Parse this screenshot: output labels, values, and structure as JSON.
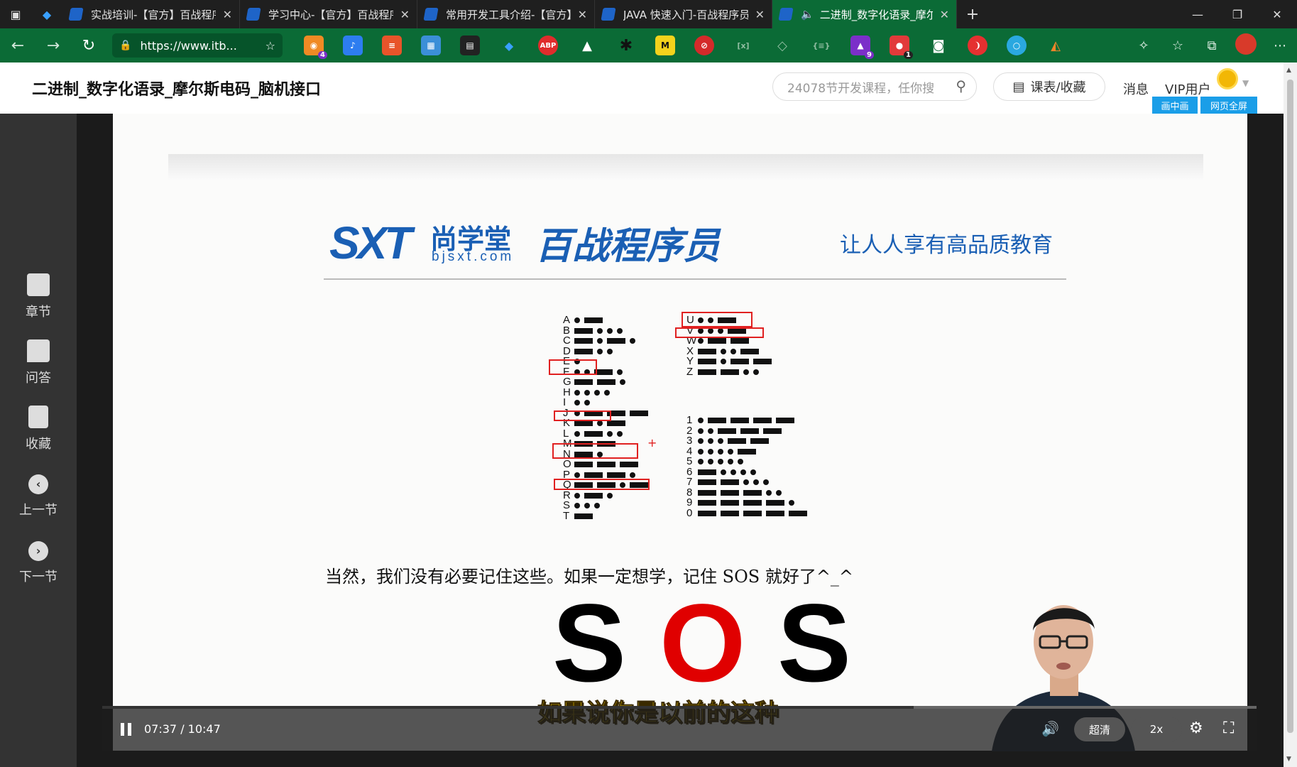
{
  "browser": {
    "tabs": [
      {
        "title": "实战培训-【官方】百战程序员",
        "active": false
      },
      {
        "title": "学习中心-【官方】百战程序员",
        "active": false
      },
      {
        "title": "常用开发工具介绍-【官方】百战",
        "active": false
      },
      {
        "title": "JAVA 快速入门-百战程序员",
        "active": false
      },
      {
        "title": "二进制_数字化语录_摩尔斯",
        "active": true
      }
    ],
    "url": "https://www.itb...",
    "extension_badges": {
      "ext1": "4",
      "ext2": "9",
      "ext3": "1"
    },
    "theme_color": "#0b6b36"
  },
  "page": {
    "title": "二进制_数字化语录_摩尔斯电码_脑机接口",
    "search_placeholder": "24078节开发课程，任你搜",
    "schedule_button": "课表/收藏",
    "messages": "消息",
    "vip": "VIP用户",
    "pip_button": "画中画",
    "webfullscreen_button": "网页全屏"
  },
  "sidebar": {
    "items": [
      {
        "label": "章节",
        "icon": "chapters-icon"
      },
      {
        "label": "问答",
        "icon": "qa-icon"
      },
      {
        "label": "收藏",
        "icon": "bookmark-icon"
      },
      {
        "label": "上一节",
        "icon": "prev-icon"
      },
      {
        "label": "下一节",
        "icon": "next-icon"
      }
    ]
  },
  "slide": {
    "logo_sxt": "SXT",
    "logo_cn": "尚学堂",
    "logo_url": "bjsxt.com",
    "logo_brand": "百战程序员",
    "slogan": "让人人享有高品质教育",
    "morse_letters": [
      {
        "ch": "A",
        "code": ".-"
      },
      {
        "ch": "B",
        "code": "-..."
      },
      {
        "ch": "C",
        "code": "-.-."
      },
      {
        "ch": "D",
        "code": "-.."
      },
      {
        "ch": "E",
        "code": "."
      },
      {
        "ch": "F",
        "code": "..-."
      },
      {
        "ch": "G",
        "code": "--."
      },
      {
        "ch": "H",
        "code": "...."
      },
      {
        "ch": "I",
        "code": ".."
      },
      {
        "ch": "J",
        "code": ".---"
      },
      {
        "ch": "K",
        "code": "-.-"
      },
      {
        "ch": "L",
        "code": ".-.."
      },
      {
        "ch": "M",
        "code": "--"
      },
      {
        "ch": "N",
        "code": "-."
      },
      {
        "ch": "O",
        "code": "---"
      },
      {
        "ch": "P",
        "code": ".--."
      },
      {
        "ch": "Q",
        "code": "--.-"
      },
      {
        "ch": "R",
        "code": ".-."
      },
      {
        "ch": "S",
        "code": "..."
      },
      {
        "ch": "T",
        "code": "-"
      }
    ],
    "morse_letters_2": [
      {
        "ch": "U",
        "code": "..-"
      },
      {
        "ch": "V",
        "code": "...-"
      },
      {
        "ch": "W",
        "code": ".--"
      },
      {
        "ch": "X",
        "code": "-..-"
      },
      {
        "ch": "Y",
        "code": "-.--"
      },
      {
        "ch": "Z",
        "code": "--.."
      }
    ],
    "morse_digits": [
      {
        "ch": "1",
        "code": ".----"
      },
      {
        "ch": "2",
        "code": "..---"
      },
      {
        "ch": "3",
        "code": "...--"
      },
      {
        "ch": "4",
        "code": "....-"
      },
      {
        "ch": "5",
        "code": "....."
      },
      {
        "ch": "6",
        "code": "-...."
      },
      {
        "ch": "7",
        "code": "--..."
      },
      {
        "ch": "8",
        "code": "---.."
      },
      {
        "ch": "9",
        "code": "----."
      },
      {
        "ch": "0",
        "code": "-----"
      }
    ],
    "caption": "当然，我们没有必要记住这些。如果一定想学，记住 SOS 就好了^_^",
    "sos": [
      "S",
      "O",
      "S"
    ],
    "sos_colors": [
      "#000000",
      "#e00000",
      "#000000"
    ]
  },
  "player": {
    "subtitle": "如果说你是以前的这种",
    "time": "07:37 / 10:47",
    "progress": 0.703,
    "quality": "超清",
    "speed": "2x"
  }
}
